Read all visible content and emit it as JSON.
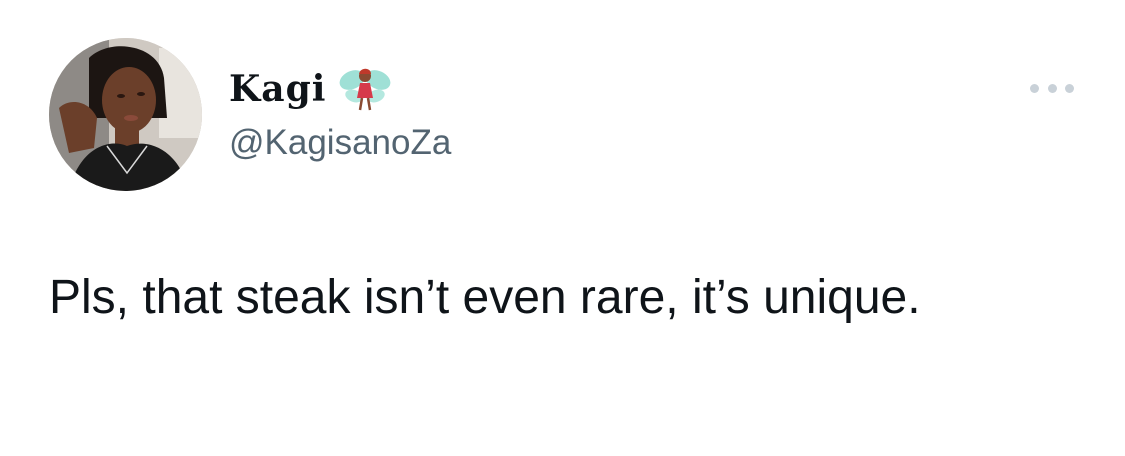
{
  "author": {
    "display_name": "Kagi",
    "handle": "@KagisanoZa",
    "name_emoji": "fairy-icon"
  },
  "tweet": {
    "text": "Pls, that steak isn’t even rare, it’s unique."
  },
  "menu": {
    "icon": "more-horizontal-icon"
  },
  "colors": {
    "text_primary": "#0f1419",
    "text_secondary": "#536471",
    "menu_dots": "#c9d1d8",
    "background": "#ffffff"
  }
}
